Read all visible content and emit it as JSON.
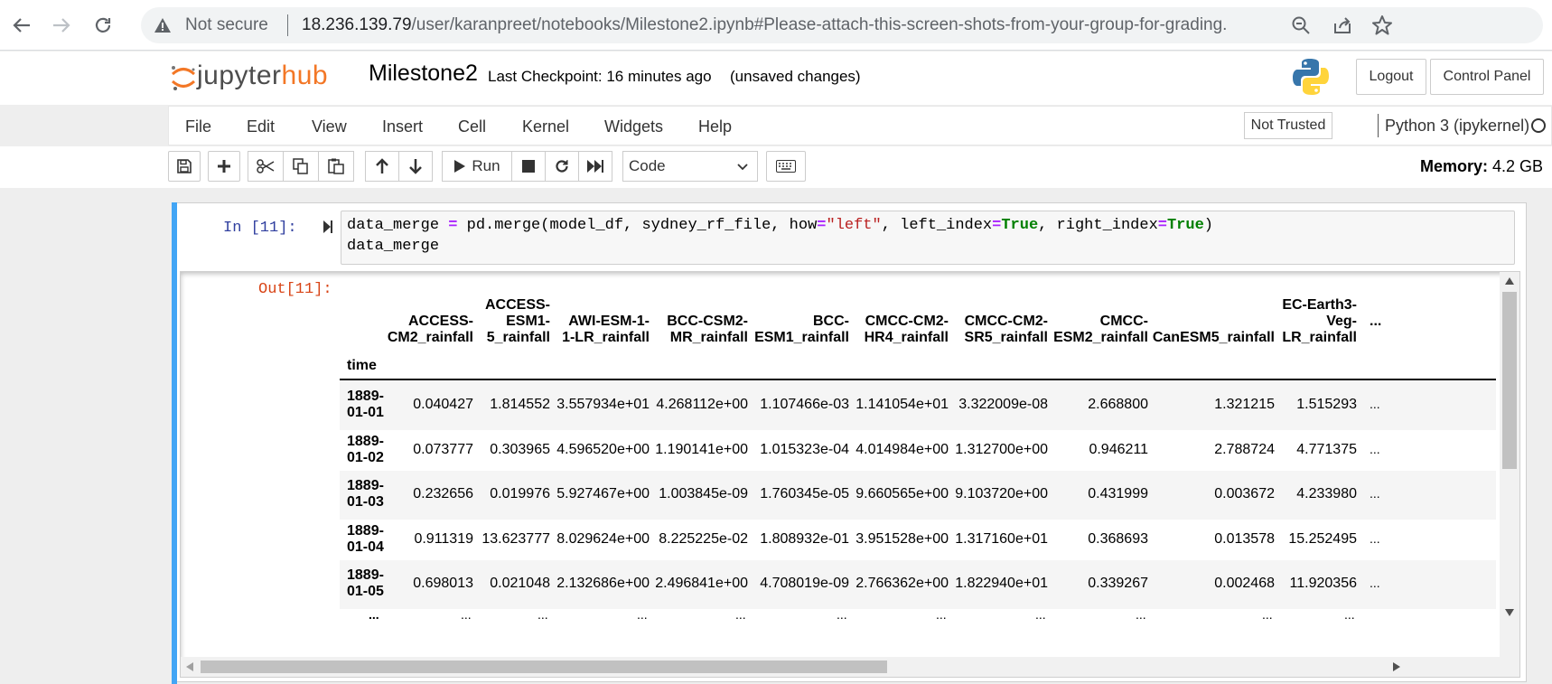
{
  "browser": {
    "security_label": "Not secure",
    "url_host": "18.236.139.79",
    "url_path": "/user/karanpreet/notebooks/Milestone2.ipynb#Please-attach-this-screen-shots-from-your-group-for-grading."
  },
  "header": {
    "logo_part1": "jupyter",
    "logo_part2": "hub",
    "notebook_title": "Milestone2",
    "checkpoint": "Last Checkpoint: 16 minutes ago",
    "unsaved": "(unsaved changes)",
    "logout_label": "Logout",
    "control_panel_label": "Control Panel"
  },
  "menu": {
    "items": [
      "File",
      "Edit",
      "View",
      "Insert",
      "Cell",
      "Kernel",
      "Widgets",
      "Help"
    ],
    "trusted_label": "Not Trusted",
    "kernel_name": "Python 3 (ipykernel)"
  },
  "toolbar": {
    "run_label": "Run",
    "cell_type": "Code",
    "memory_label": "Memory:",
    "memory_value": "4.2 GB"
  },
  "cell": {
    "in_prompt": "In [11]:",
    "out_prompt": "Out[11]:",
    "code": {
      "l1_a": "data_merge ",
      "l1_op1": "=",
      "l1_b": " pd.merge(model_df, sydney_rf_file, how",
      "l1_op2": "=",
      "l1_str": "\"left\"",
      "l1_c": ", left_index",
      "l1_op3": "=",
      "l1_kw1": "True",
      "l1_d": ", right_index",
      "l1_op4": "=",
      "l1_kw2": "True",
      "l1_e": ")",
      "l2": "data_merge"
    }
  },
  "table": {
    "index_name": "time",
    "columns": [
      [
        "ACCESS-",
        "CM2_rainfall"
      ],
      [
        "ACCESS-",
        "ESM1-",
        "5_rainfall"
      ],
      [
        "AWI-ESM-1-",
        "1-LR_rainfall"
      ],
      [
        "BCC-CSM2-",
        "MR_rainfall"
      ],
      [
        "BCC-",
        "ESM1_rainfall"
      ],
      [
        "CMCC-CM2-",
        "HR4_rainfall"
      ],
      [
        "CMCC-CM2-",
        "SR5_rainfall"
      ],
      [
        "CMCC-",
        "ESM2_rainfall"
      ],
      [
        "CanESM5_rainfall"
      ],
      [
        "EC-Earth3-",
        "Veg-",
        "LR_rainfall"
      ]
    ],
    "ellipsis": "...",
    "rows": [
      {
        "index": [
          "1889-",
          "01-01"
        ],
        "values": [
          "0.040427",
          "1.814552",
          "3.557934e+01",
          "4.268112e+00",
          "1.107466e-03",
          "1.141054e+01",
          "3.322009e-08",
          "2.668800",
          "1.321215",
          "1.515293"
        ]
      },
      {
        "index": [
          "1889-",
          "01-02"
        ],
        "values": [
          "0.073777",
          "0.303965",
          "4.596520e+00",
          "1.190141e+00",
          "1.015323e-04",
          "4.014984e+00",
          "1.312700e+00",
          "0.946211",
          "2.788724",
          "4.771375"
        ]
      },
      {
        "index": [
          "1889-",
          "01-03"
        ],
        "values": [
          "0.232656",
          "0.019976",
          "5.927467e+00",
          "1.003845e-09",
          "1.760345e-05",
          "9.660565e+00",
          "9.103720e+00",
          "0.431999",
          "0.003672",
          "4.233980"
        ]
      },
      {
        "index": [
          "1889-",
          "01-04"
        ],
        "values": [
          "0.911319",
          "13.623777",
          "8.029624e+00",
          "8.225225e-02",
          "1.808932e-01",
          "3.951528e+00",
          "1.317160e+01",
          "0.368693",
          "0.013578",
          "15.252495"
        ]
      },
      {
        "index": [
          "1889-",
          "01-05"
        ],
        "values": [
          "0.698013",
          "0.021048",
          "2.132686e+00",
          "2.496841e+00",
          "4.708019e-09",
          "2.766362e+00",
          "1.822940e+01",
          "0.339267",
          "0.002468",
          "11.920356"
        ]
      }
    ]
  },
  "colors": {
    "accent": "#42a5f5",
    "jupyter_orange": "#f37726",
    "in_prompt": "#303f9f",
    "out_prompt": "#d84315"
  }
}
